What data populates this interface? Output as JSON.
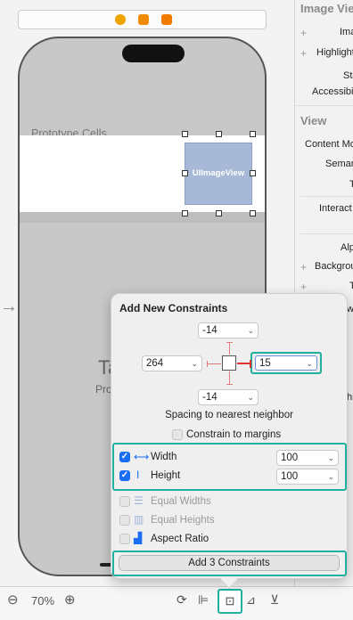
{
  "canvas": {
    "prototype_cells_label": "Prototype Cells",
    "image_view_label": "UIImageView",
    "big_text": "Ta",
    "small_text": "Pro",
    "entry_arrow_icon": "arrow-right-icon"
  },
  "bottom_bar": {
    "zoom_out_icon": "zoom-out-icon",
    "zoom_level": "70%",
    "zoom_in_icon": "zoom-in-icon"
  },
  "inspector": {
    "section1_title": "Image Vie",
    "image_label": "Ima",
    "highlighted_label": "Highlight",
    "state_label": "Sta",
    "accessibility_label": "Accessibi",
    "section2_title": "View",
    "content_mode_label": "Content Mo",
    "semantic_label": "Seman",
    "tag_label": "T",
    "interaction_label": "Interact",
    "alpha_label": "Alp",
    "background_label": "Backgrou",
    "tint_label": "T",
    "extra_label": "wi",
    "extra2_label": "hi"
  },
  "popover": {
    "title": "Add New Constraints",
    "top_value": "-14",
    "left_value": "264",
    "right_value": "15",
    "bottom_value": "-14",
    "spacing_label": "Spacing to nearest neighbor",
    "constrain_margins_label": "Constrain to margins",
    "width_label": "Width",
    "width_value": "100",
    "height_label": "Height",
    "height_value": "100",
    "equal_widths_label": "Equal Widths",
    "equal_heights_label": "Equal Heights",
    "aspect_ratio_label": "Aspect Ratio",
    "add_button_label": "Add 3 Constraints"
  }
}
